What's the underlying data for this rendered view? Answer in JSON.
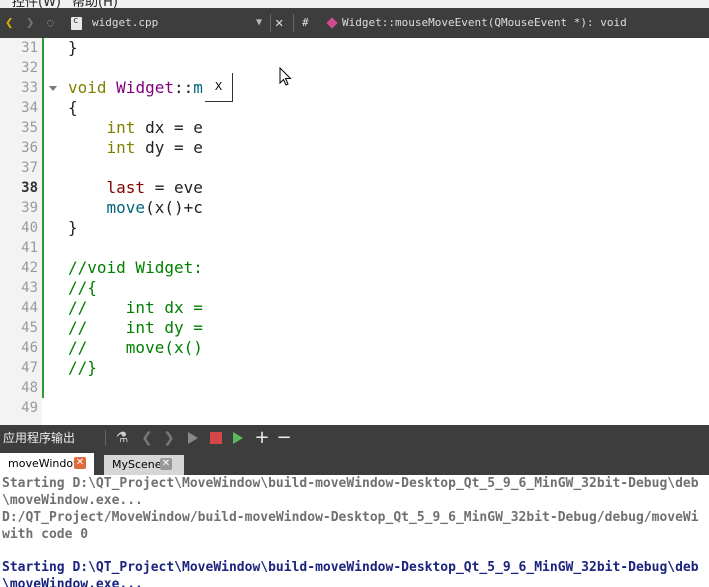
{
  "menubar": {
    "items": [
      "控件(W)",
      "帮助(H)"
    ]
  },
  "toolbar": {
    "back_icon": "back-arrow-icon",
    "forward_icon": "forward-arrow-icon",
    "file_name": "widget.cpp",
    "hash_label": "#",
    "symbol": "Widget::mouseMoveEvent(QMouseEvent *): void"
  },
  "editor": {
    "line_numbers": [
      "31",
      "32",
      "33",
      "34",
      "35",
      "36",
      "37",
      "38",
      "39",
      "40",
      "41",
      "42",
      "43",
      "44",
      "45",
      "46",
      "47",
      "48",
      "49"
    ],
    "current_line": "38",
    "lines": {
      "l31": "}",
      "l33_kw": "void",
      "l33_cls": "Widget",
      "l33_sep": "::",
      "l33_fn": "m",
      "l34": "{",
      "l35_kw": "int",
      "l35_rest": " dx = e",
      "l36_kw": "int",
      "l36_rest": " dy = e",
      "l38_var": "last",
      "l38_rest": " = eve",
      "l39_fn": "move",
      "l39_rest": "(x()+c",
      "l40": "}",
      "l42": "//void Widget:",
      "l43": "//{",
      "l44": "//    int dx =",
      "l45": "//    int dy =",
      "l46": "//    move(x()",
      "l47": "//}"
    }
  },
  "popup": {
    "close_label": "X"
  },
  "output_pane": {
    "title": "应用程序输出",
    "tabs": [
      {
        "label": "moveWindow"
      },
      {
        "label": "MyScene"
      }
    ],
    "lines": [
      "Starting D:\\QT_Project\\MoveWindow\\build-moveWindow-Desktop_Qt_5_9_6_MinGW_32bit-Debug\\deb",
      "\\moveWindow.exe...",
      "D:/QT_Project/MoveWindow/build-moveWindow-Desktop_Qt_5_9_6_MinGW_32bit-Debug/debug/moveWi",
      "with code 0",
      "",
      "Starting D:\\QT_Project\\MoveWindow\\build-moveWindow-Desktop_Qt_5_9_6_MinGW_32bit-Debug\\deb",
      "\\moveWindow.exe..."
    ]
  },
  "colors": {
    "accent": "#2e9a2e",
    "toolbar": "#3d3d3d",
    "close_tab": "#e06c3c"
  }
}
